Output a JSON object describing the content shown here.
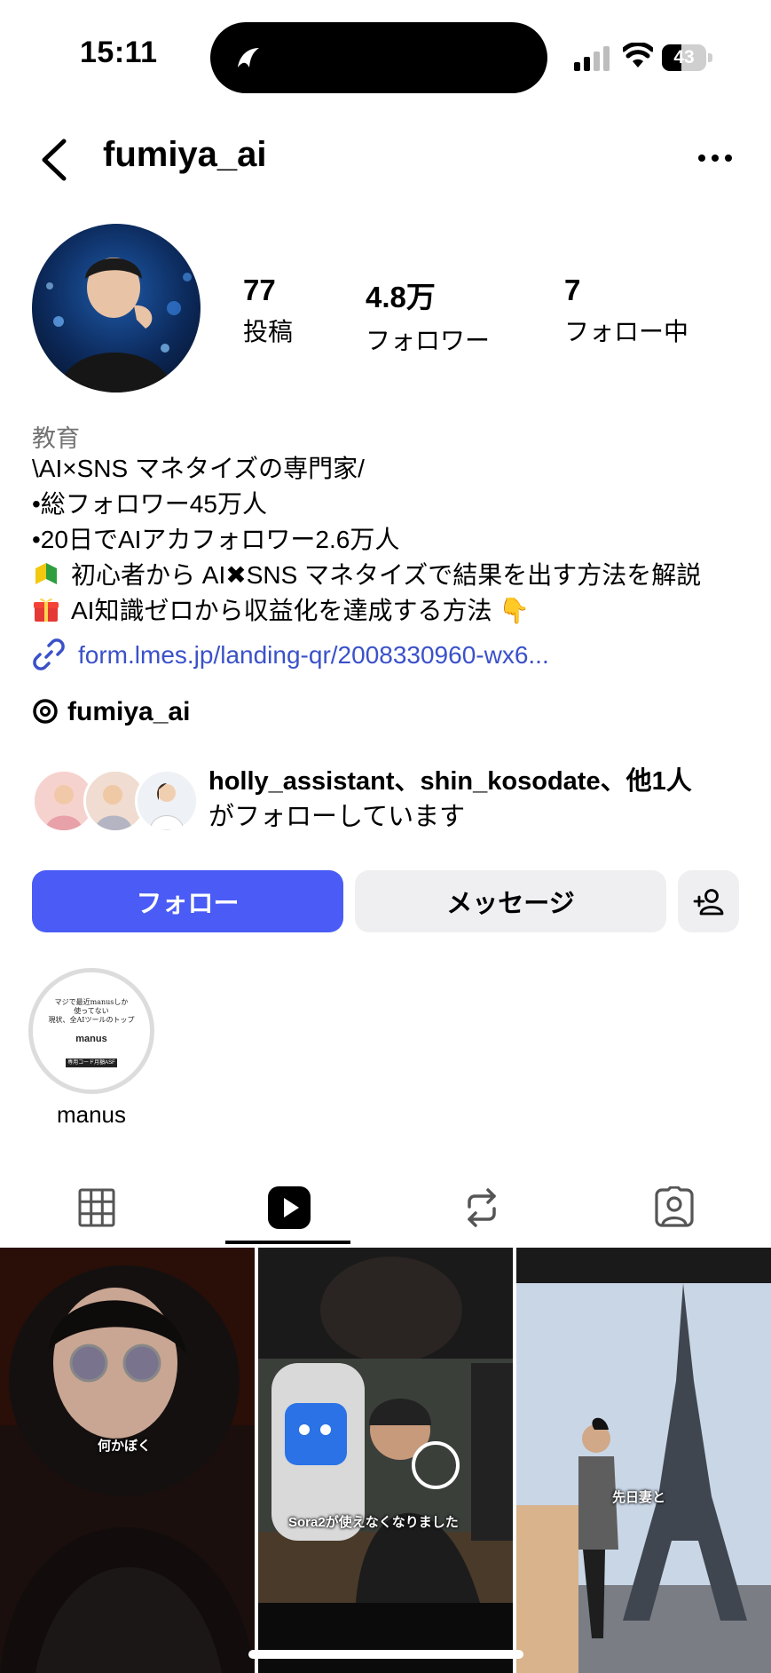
{
  "status_bar": {
    "time": "15:11",
    "battery": "43",
    "battery_level": 0.43
  },
  "header": {
    "username": "fumiya_ai"
  },
  "profile": {
    "stats": [
      {
        "value": "77",
        "label": "投稿"
      },
      {
        "value": "4.8万",
        "label": "フォロワー"
      },
      {
        "value": "7",
        "label": "フォロー中"
      }
    ],
    "category": "教育",
    "bio": {
      "line1": "\\AI×SNS マネタイズの専門家/",
      "line2": "•総フォロワー45万人",
      "line3": "•20日でAIアカフォロワー2.6万人",
      "line4": "初心者から AI✖SNS マネタイズで結果を出す方法を解説",
      "line5": "AI知識ゼロから収益化を達成する方法",
      "pointing": "👇"
    },
    "link": "form.lmes.jp/landing-qr/2008330960-wx6...",
    "threads_handle": "fumiya_ai",
    "followed_by": {
      "names": "holly_assistant、shin_kosodate、他1人",
      "suffix": "がフォローしています"
    }
  },
  "actions": {
    "follow": "フォロー",
    "message": "メッセージ"
  },
  "highlights": [
    {
      "label": "manus",
      "cover_caption_1": "マジで最近manusしか",
      "cover_caption_2": "使ってない",
      "cover_caption_3": "現状、全AIツールのトップ",
      "cover_logo": "manus",
      "cover_tag": "専用コード月額ASF"
    }
  ],
  "tabs": [
    "grid-tab",
    "reels-tab",
    "reposts-tab",
    "tagged-tab"
  ],
  "active_tab": "reels-tab",
  "reels": [
    {
      "caption": "何かぼく"
    },
    {
      "caption": "Sora2が使えなくなりました"
    },
    {
      "caption": "先日妻と"
    }
  ],
  "colors": {
    "accent": "#4a5cf5",
    "link": "#3b51c9",
    "muted": "#737373",
    "button_bg": "#efeff1"
  }
}
